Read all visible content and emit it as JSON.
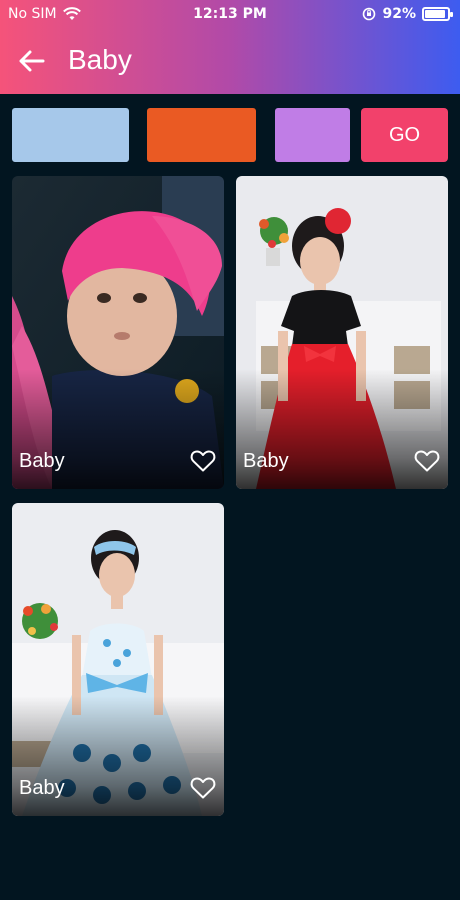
{
  "status": {
    "carrier": "No SIM",
    "time": "12:13 PM",
    "battery": "92%",
    "battery_level": 0.92
  },
  "header": {
    "title": "Baby",
    "back_icon": "arrow-left-icon"
  },
  "filters": {
    "swatches": [
      {
        "name": "light-blue",
        "color": "#a6c8ea"
      },
      {
        "name": "orange",
        "color": "#ea5a23"
      },
      {
        "name": "purple",
        "color": "#c07de6"
      }
    ],
    "go_label": "GO",
    "go_color": "#f2416b"
  },
  "cards": [
    {
      "label": "Baby",
      "icon": "heart-outline-icon"
    },
    {
      "label": "Baby",
      "icon": "heart-outline-icon"
    },
    {
      "label": "Baby",
      "icon": "heart-outline-icon"
    }
  ]
}
